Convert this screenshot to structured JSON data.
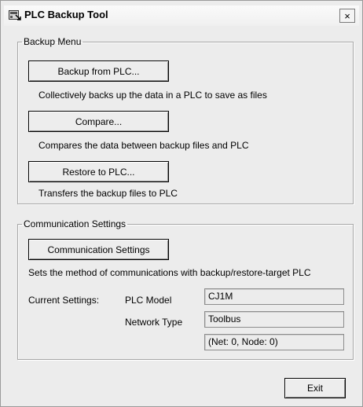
{
  "window": {
    "title": "PLC Backup Tool",
    "close_label": "×"
  },
  "backup_menu": {
    "legend": "Backup Menu",
    "backup_button": "Backup from PLC...",
    "backup_desc": "Collectively backs up the data in a PLC to save as files",
    "compare_button": "Compare...",
    "compare_desc": "Compares the data between backup files and PLC",
    "restore_button": "Restore to PLC...",
    "restore_desc": "Transfers the backup files to PLC"
  },
  "communication": {
    "legend": "Communication Settings",
    "settings_button": "Communication Settings",
    "settings_desc": "Sets the method of communications with backup/restore-target PLC",
    "current_settings_label": "Current Settings:",
    "plc_model_label": "PLC Model",
    "plc_model_value": "CJ1M",
    "network_type_label": "Network Type",
    "network_type_value": "Toolbus",
    "net_node_value": "(Net: 0, Node: 0)"
  },
  "footer": {
    "exit_button": "Exit"
  },
  "icons": {
    "app": "plc-backup-icon",
    "close": "close-icon"
  }
}
